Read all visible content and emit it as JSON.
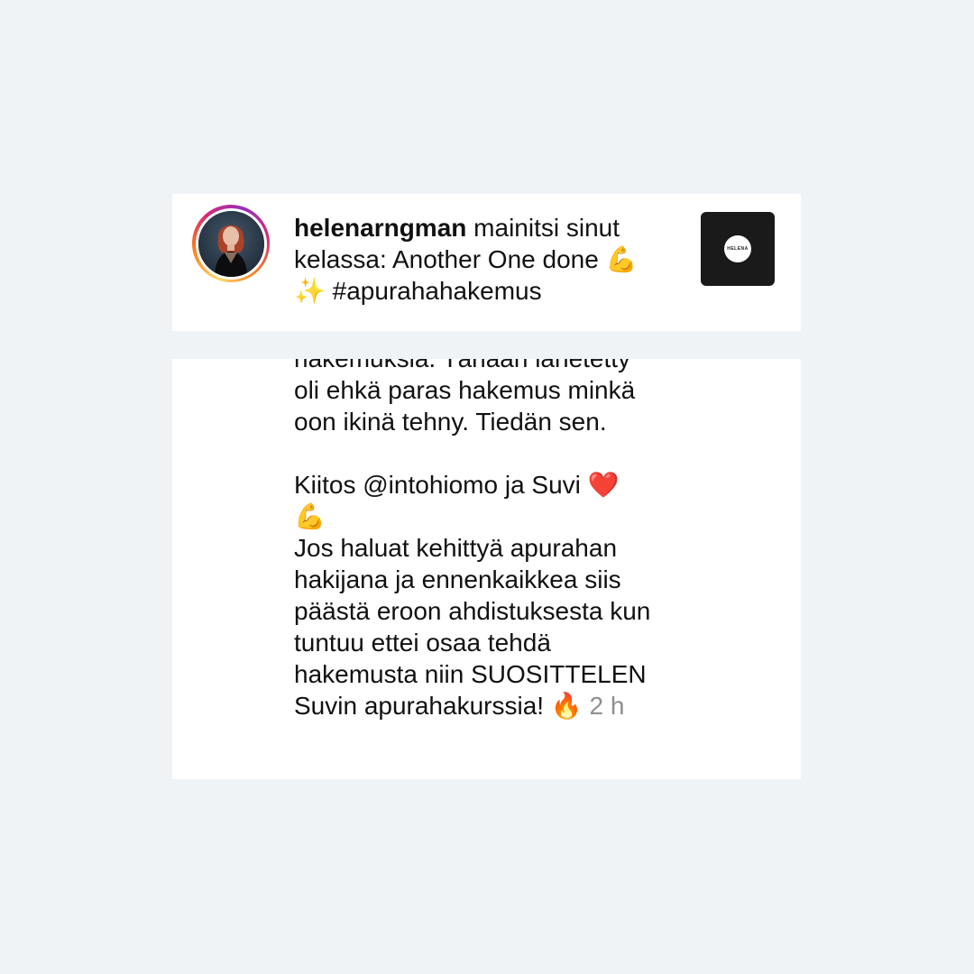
{
  "notification": {
    "username": "helenarngman",
    "action_text": " mainitsi sinut kelassa: Another One done ",
    "emoji_1": "💪",
    "emoji_2": "✨",
    "hashtag": " #apurahahakemus",
    "thumbnail_logo_text": "HELENA"
  },
  "comment": {
    "line_partial": "hakemuksia. Tänään lähetetty",
    "line_2": "oli ehkä paras hakemus minkä",
    "line_3": "oon ikinä tehny. Tiedän sen.",
    "thanks_text": "Kiitos @intohiomo ja Suvi ",
    "thanks_emoji_heart": "❤️",
    "thanks_emoji_muscle": "💪",
    "recommend_line_1": "Jos haluat kehittyä apurahan",
    "recommend_line_2": "hakijana ja ennenkaikkea siis",
    "recommend_line_3": "päästä eroon ahdistuksesta kun",
    "recommend_line_4": "tuntuu ettei osaa tehdä",
    "recommend_line_5": "hakemusta niin SUOSITTELEN",
    "recommend_line_6": "Suvin apurahakurssia! ",
    "fire_emoji": "🔥",
    "timestamp": "2 h"
  }
}
